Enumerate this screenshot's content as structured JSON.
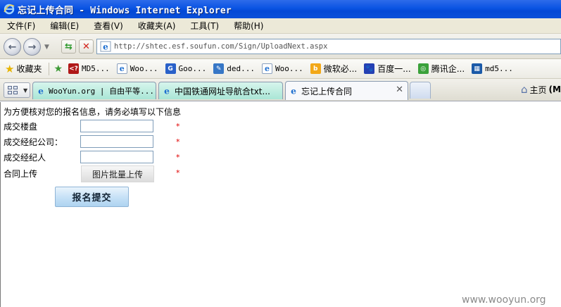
{
  "window": {
    "title": "忘记上传合同 - Windows Internet Explorer"
  },
  "menu": [
    "文件(F)",
    "编辑(E)",
    "查看(V)",
    "收藏夹(A)",
    "工具(T)",
    "帮助(H)"
  ],
  "address": {
    "url": "http://shtec.esf.soufun.com/Sign/UploadNext.aspx"
  },
  "favorites": {
    "label": "收藏夹",
    "items": [
      {
        "label": "MD5...",
        "icon": "md5-icon",
        "color": "#b01818",
        "glyph": "<?"
      },
      {
        "label": "Woo...",
        "icon": "ie-page-icon",
        "color": "#1e6fd0",
        "glyph": "e"
      },
      {
        "label": "Goo...",
        "icon": "google-icon",
        "color": "#2a61c9",
        "glyph": "G"
      },
      {
        "label": "ded...",
        "icon": "tools-icon",
        "color": "#3777c6",
        "glyph": "✎"
      },
      {
        "label": "Woo...",
        "icon": "ie-page-icon",
        "color": "#1e6fd0",
        "glyph": "e"
      },
      {
        "label": "微软必...",
        "icon": "bing-icon",
        "color": "#f2a818",
        "glyph": "b"
      },
      {
        "label": "百度一...",
        "icon": "baidu-icon",
        "color": "#2440b3",
        "glyph": "🐾"
      },
      {
        "label": "腾讯企...",
        "icon": "tencent-icon",
        "color": "#3aa13a",
        "glyph": "◎"
      },
      {
        "label": "md5...",
        "icon": "grid-icon",
        "color": "#1b5aa8",
        "glyph": "▦"
      }
    ]
  },
  "tabs": [
    {
      "label": "WooYun.org | 自由平等...",
      "state": "inactive"
    },
    {
      "label": "中国铁通网址导航合txt...",
      "state": "inactive"
    },
    {
      "label": "忘记上传合同",
      "state": "active"
    }
  ],
  "home_label": "主页",
  "home_more": "(M",
  "form": {
    "intro": "为方便核对您的报名信息，请务必填写以下信息",
    "fields": [
      {
        "label": "成交楼盘",
        "value": ""
      },
      {
        "label": "成交经纪公司：",
        "value": ""
      },
      {
        "label": "成交经纪人",
        "value": ""
      }
    ],
    "upload_label": "合同上传",
    "upload_button": "图片批量上传",
    "required_mark": "*",
    "submit_button": "报名提交"
  },
  "watermark": "www.wooyun.org",
  "colors": {
    "titlebar": "#0a54e3",
    "required": "#e00000"
  }
}
